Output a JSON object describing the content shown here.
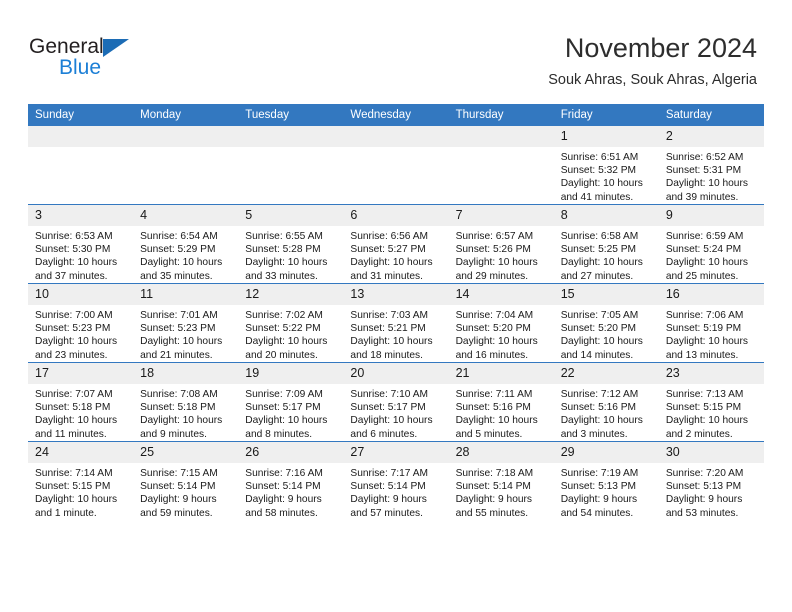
{
  "brand": {
    "name_part1": "General",
    "name_part2": "Blue",
    "logo_icon": "blue-triangle-icon",
    "accent_color": "#1c7fd6"
  },
  "header": {
    "title": "November 2024",
    "subtitle": "Souk Ahras, Souk Ahras, Algeria"
  },
  "colors": {
    "header_row_bg": "#3378c0",
    "day_number_bg": "#efefef",
    "row_divider": "#3378c0",
    "text": "#1a1a1a"
  },
  "weekday_headers": [
    "Sunday",
    "Monday",
    "Tuesday",
    "Wednesday",
    "Thursday",
    "Friday",
    "Saturday"
  ],
  "labels": {
    "sunrise_prefix": "Sunrise:",
    "sunset_prefix": "Sunset:",
    "daylight_prefix": "Daylight:"
  },
  "weeks": [
    [
      {
        "day": "",
        "blank": true,
        "sunrise": "",
        "sunset": "",
        "daylight": ""
      },
      {
        "day": "",
        "blank": true,
        "sunrise": "",
        "sunset": "",
        "daylight": ""
      },
      {
        "day": "",
        "blank": true,
        "sunrise": "",
        "sunset": "",
        "daylight": ""
      },
      {
        "day": "",
        "blank": true,
        "sunrise": "",
        "sunset": "",
        "daylight": ""
      },
      {
        "day": "",
        "blank": true,
        "sunrise": "",
        "sunset": "",
        "daylight": ""
      },
      {
        "day": "1",
        "blank": false,
        "sunrise": "Sunrise: 6:51 AM",
        "sunset": "Sunset: 5:32 PM",
        "daylight": "Daylight: 10 hours and 41 minutes."
      },
      {
        "day": "2",
        "blank": false,
        "sunrise": "Sunrise: 6:52 AM",
        "sunset": "Sunset: 5:31 PM",
        "daylight": "Daylight: 10 hours and 39 minutes."
      }
    ],
    [
      {
        "day": "3",
        "blank": false,
        "sunrise": "Sunrise: 6:53 AM",
        "sunset": "Sunset: 5:30 PM",
        "daylight": "Daylight: 10 hours and 37 minutes."
      },
      {
        "day": "4",
        "blank": false,
        "sunrise": "Sunrise: 6:54 AM",
        "sunset": "Sunset: 5:29 PM",
        "daylight": "Daylight: 10 hours and 35 minutes."
      },
      {
        "day": "5",
        "blank": false,
        "sunrise": "Sunrise: 6:55 AM",
        "sunset": "Sunset: 5:28 PM",
        "daylight": "Daylight: 10 hours and 33 minutes."
      },
      {
        "day": "6",
        "blank": false,
        "sunrise": "Sunrise: 6:56 AM",
        "sunset": "Sunset: 5:27 PM",
        "daylight": "Daylight: 10 hours and 31 minutes."
      },
      {
        "day": "7",
        "blank": false,
        "sunrise": "Sunrise: 6:57 AM",
        "sunset": "Sunset: 5:26 PM",
        "daylight": "Daylight: 10 hours and 29 minutes."
      },
      {
        "day": "8",
        "blank": false,
        "sunrise": "Sunrise: 6:58 AM",
        "sunset": "Sunset: 5:25 PM",
        "daylight": "Daylight: 10 hours and 27 minutes."
      },
      {
        "day": "9",
        "blank": false,
        "sunrise": "Sunrise: 6:59 AM",
        "sunset": "Sunset: 5:24 PM",
        "daylight": "Daylight: 10 hours and 25 minutes."
      }
    ],
    [
      {
        "day": "10",
        "blank": false,
        "sunrise": "Sunrise: 7:00 AM",
        "sunset": "Sunset: 5:23 PM",
        "daylight": "Daylight: 10 hours and 23 minutes."
      },
      {
        "day": "11",
        "blank": false,
        "sunrise": "Sunrise: 7:01 AM",
        "sunset": "Sunset: 5:23 PM",
        "daylight": "Daylight: 10 hours and 21 minutes."
      },
      {
        "day": "12",
        "blank": false,
        "sunrise": "Sunrise: 7:02 AM",
        "sunset": "Sunset: 5:22 PM",
        "daylight": "Daylight: 10 hours and 20 minutes."
      },
      {
        "day": "13",
        "blank": false,
        "sunrise": "Sunrise: 7:03 AM",
        "sunset": "Sunset: 5:21 PM",
        "daylight": "Daylight: 10 hours and 18 minutes."
      },
      {
        "day": "14",
        "blank": false,
        "sunrise": "Sunrise: 7:04 AM",
        "sunset": "Sunset: 5:20 PM",
        "daylight": "Daylight: 10 hours and 16 minutes."
      },
      {
        "day": "15",
        "blank": false,
        "sunrise": "Sunrise: 7:05 AM",
        "sunset": "Sunset: 5:20 PM",
        "daylight": "Daylight: 10 hours and 14 minutes."
      },
      {
        "day": "16",
        "blank": false,
        "sunrise": "Sunrise: 7:06 AM",
        "sunset": "Sunset: 5:19 PM",
        "daylight": "Daylight: 10 hours and 13 minutes."
      }
    ],
    [
      {
        "day": "17",
        "blank": false,
        "sunrise": "Sunrise: 7:07 AM",
        "sunset": "Sunset: 5:18 PM",
        "daylight": "Daylight: 10 hours and 11 minutes."
      },
      {
        "day": "18",
        "blank": false,
        "sunrise": "Sunrise: 7:08 AM",
        "sunset": "Sunset: 5:18 PM",
        "daylight": "Daylight: 10 hours and 9 minutes."
      },
      {
        "day": "19",
        "blank": false,
        "sunrise": "Sunrise: 7:09 AM",
        "sunset": "Sunset: 5:17 PM",
        "daylight": "Daylight: 10 hours and 8 minutes."
      },
      {
        "day": "20",
        "blank": false,
        "sunrise": "Sunrise: 7:10 AM",
        "sunset": "Sunset: 5:17 PM",
        "daylight": "Daylight: 10 hours and 6 minutes."
      },
      {
        "day": "21",
        "blank": false,
        "sunrise": "Sunrise: 7:11 AM",
        "sunset": "Sunset: 5:16 PM",
        "daylight": "Daylight: 10 hours and 5 minutes."
      },
      {
        "day": "22",
        "blank": false,
        "sunrise": "Sunrise: 7:12 AM",
        "sunset": "Sunset: 5:16 PM",
        "daylight": "Daylight: 10 hours and 3 minutes."
      },
      {
        "day": "23",
        "blank": false,
        "sunrise": "Sunrise: 7:13 AM",
        "sunset": "Sunset: 5:15 PM",
        "daylight": "Daylight: 10 hours and 2 minutes."
      }
    ],
    [
      {
        "day": "24",
        "blank": false,
        "sunrise": "Sunrise: 7:14 AM",
        "sunset": "Sunset: 5:15 PM",
        "daylight": "Daylight: 10 hours and 1 minute."
      },
      {
        "day": "25",
        "blank": false,
        "sunrise": "Sunrise: 7:15 AM",
        "sunset": "Sunset: 5:14 PM",
        "daylight": "Daylight: 9 hours and 59 minutes."
      },
      {
        "day": "26",
        "blank": false,
        "sunrise": "Sunrise: 7:16 AM",
        "sunset": "Sunset: 5:14 PM",
        "daylight": "Daylight: 9 hours and 58 minutes."
      },
      {
        "day": "27",
        "blank": false,
        "sunrise": "Sunrise: 7:17 AM",
        "sunset": "Sunset: 5:14 PM",
        "daylight": "Daylight: 9 hours and 57 minutes."
      },
      {
        "day": "28",
        "blank": false,
        "sunrise": "Sunrise: 7:18 AM",
        "sunset": "Sunset: 5:14 PM",
        "daylight": "Daylight: 9 hours and 55 minutes."
      },
      {
        "day": "29",
        "blank": false,
        "sunrise": "Sunrise: 7:19 AM",
        "sunset": "Sunset: 5:13 PM",
        "daylight": "Daylight: 9 hours and 54 minutes."
      },
      {
        "day": "30",
        "blank": false,
        "sunrise": "Sunrise: 7:20 AM",
        "sunset": "Sunset: 5:13 PM",
        "daylight": "Daylight: 9 hours and 53 minutes."
      }
    ]
  ]
}
